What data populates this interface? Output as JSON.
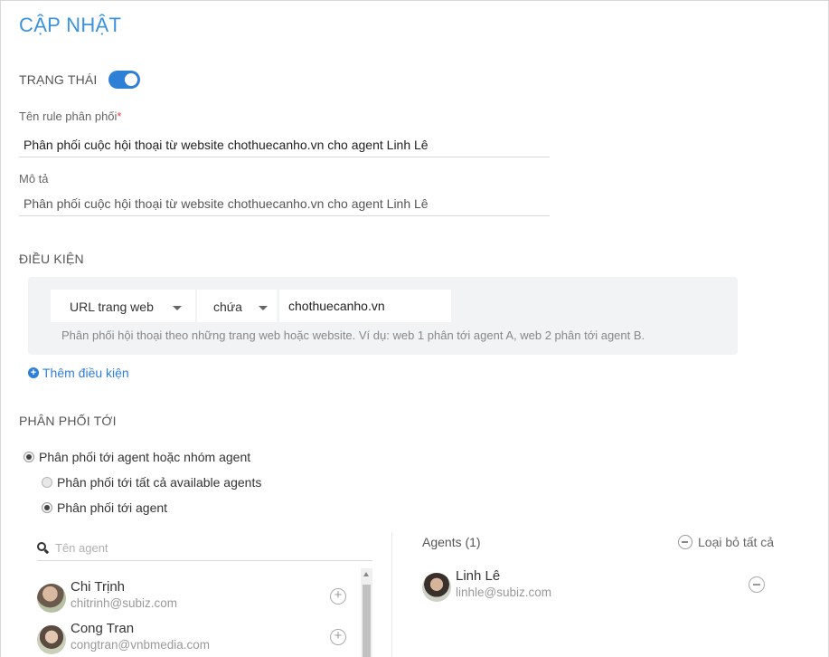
{
  "page": {
    "title": "CẬP NHẬT"
  },
  "status": {
    "label": "TRẠNG THÁI",
    "enabled": true
  },
  "rule_name": {
    "label": "Tên rule phân phối",
    "required_mark": "*",
    "value": "Phân phối cuộc hội thoại từ website chothuecanho.vn cho agent Linh Lê"
  },
  "description": {
    "label": "Mô tả",
    "value": "Phân phối cuộc hội thoại từ website chothuecanho.vn cho agent Linh Lê"
  },
  "conditions": {
    "label": "ĐIỀU KIỆN",
    "field_select": "URL trang web",
    "operator_select": "chứa",
    "value": "chothuecanho.vn",
    "hint": "Phân phối hội thoại theo những trang web hoặc website. Ví dụ: web 1 phân tới agent A, web 2 phân tới agent B.",
    "add_label": "Thêm điều kiện"
  },
  "distribute": {
    "label": "PHÂN PHỐI TỚI",
    "option_main": "Phân phối tới agent hoặc nhóm agent",
    "option_all": "Phân phối tới tất cả available agents",
    "option_agent": "Phân phối tới agent"
  },
  "agent_search": {
    "placeholder": "Tên agent"
  },
  "available_agents": [
    {
      "name": "Chi Trịnh",
      "email": "chitrinh@subiz.com"
    },
    {
      "name": "Cong Tran",
      "email": "congtran@vnbmedia.com"
    }
  ],
  "selected": {
    "header": "Agents (1)",
    "remove_all_label": "Loại bỏ tất cả",
    "agents": [
      {
        "name": "Linh Lê",
        "email": "linhle@subiz.com"
      }
    ]
  },
  "colors": {
    "accent": "#2e7fd8",
    "title": "#3b93e0",
    "required": "#e0443c"
  }
}
